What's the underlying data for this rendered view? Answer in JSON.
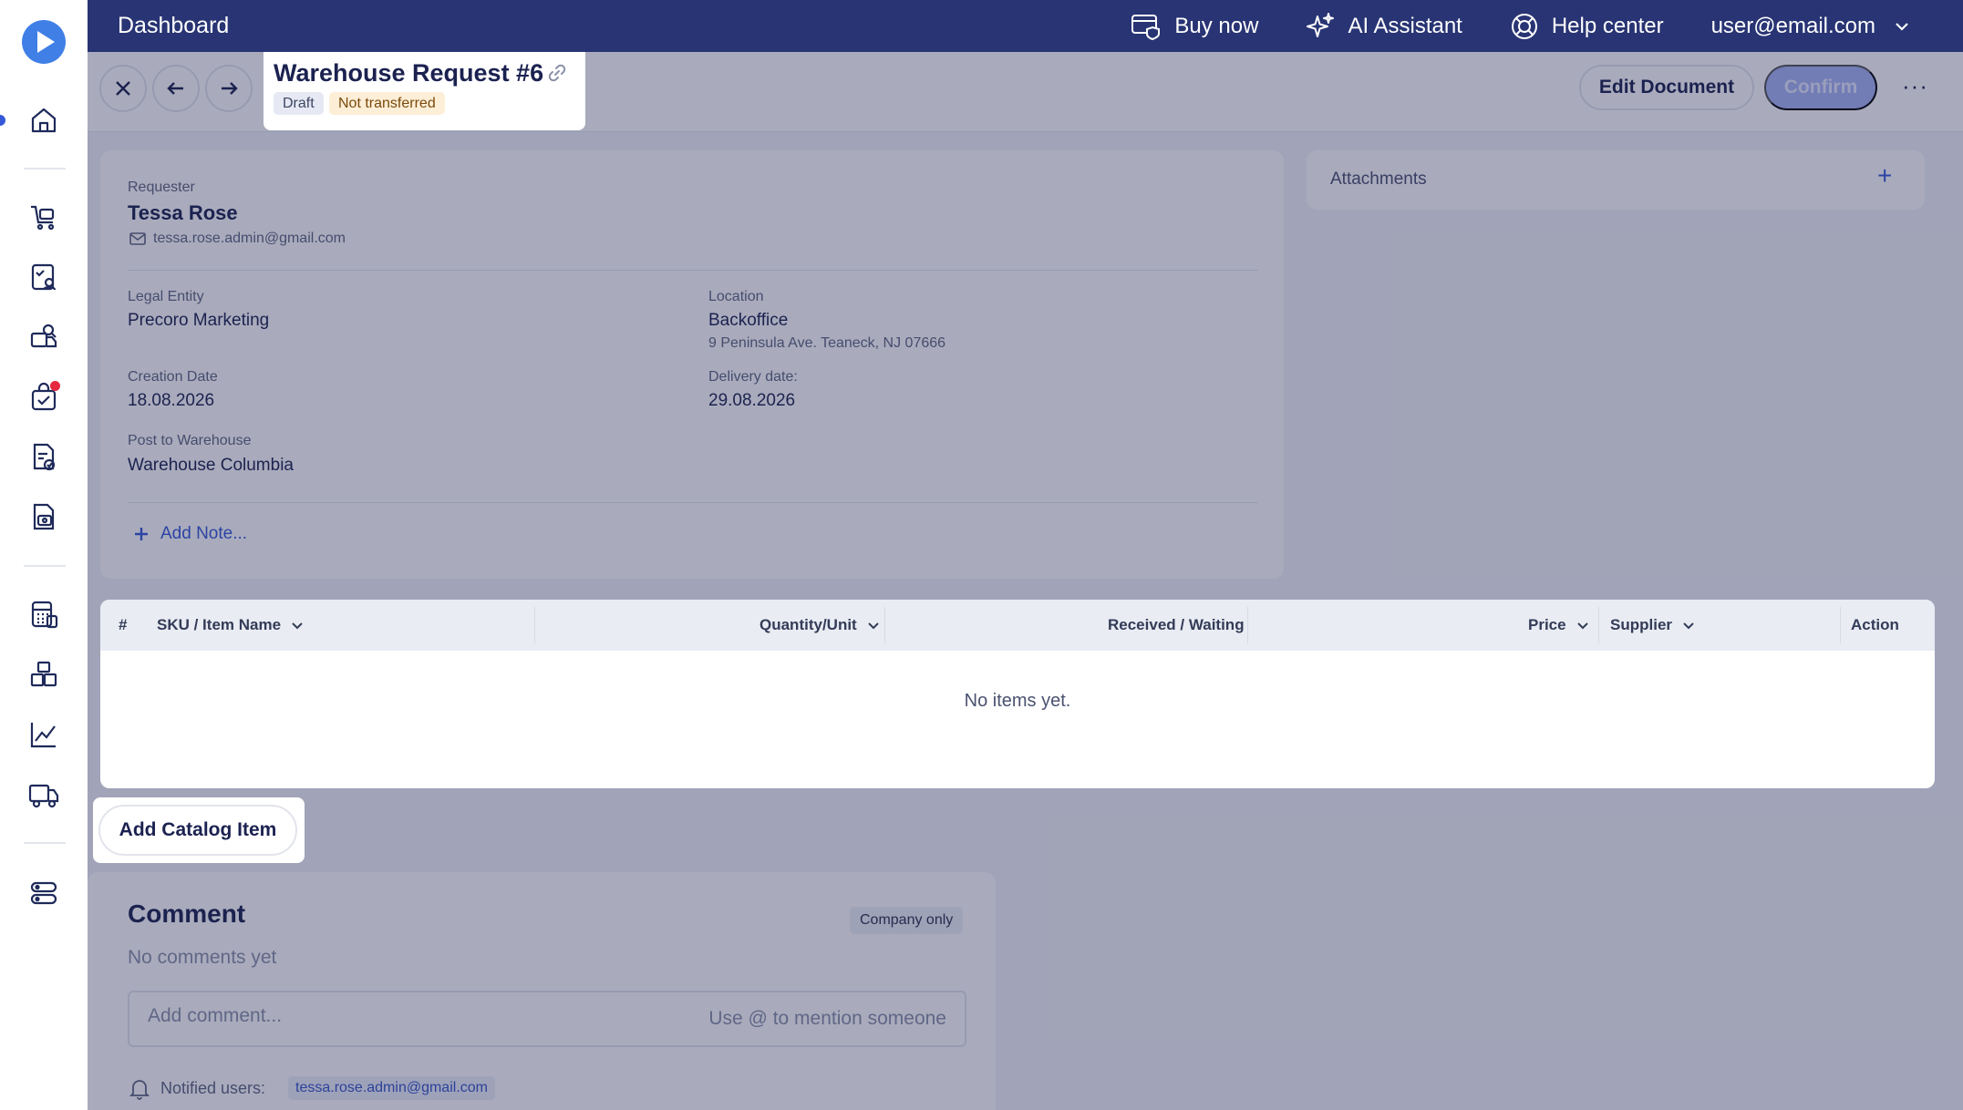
{
  "topnav": {
    "title": "Dashboard",
    "buy_now": "Buy now",
    "ai_assistant": "AI Assistant",
    "help_center": "Help center",
    "user_email": "user@email.com"
  },
  "document": {
    "title": "Warehouse Request #6",
    "status_draft": "Draft",
    "status_transfer": "Not transferred",
    "edit_label": "Edit Document",
    "confirm_label": "Confirm",
    "more_label": "···"
  },
  "details": {
    "requester_label": "Requester",
    "requester_name": "Tessa Rose",
    "requester_email": "tessa.rose.admin@gmail.com",
    "legal_entity_label": "Legal Entity",
    "legal_entity": "Precoro Marketing",
    "location_label": "Location",
    "location": "Backoffice",
    "location_address": "9 Peninsula Ave. Teaneck, NJ 07666",
    "creation_date_label": "Creation Date",
    "creation_date": "18.08.2026",
    "delivery_date_label": "Delivery date:",
    "delivery_date": "29.08.2026",
    "post_to_label": "Post to Warehouse",
    "post_to": "Warehouse Columbia",
    "add_note": "Add Note..."
  },
  "attachments": {
    "title": "Attachments",
    "add": "+"
  },
  "items_table": {
    "columns": [
      "#",
      "SKU / Item Name",
      "Quantity/Unit",
      "Received / Waiting",
      "Price",
      "Supplier",
      "Action"
    ],
    "empty_text": "No items yet.",
    "add_catalog_item": "Add Catalog Item"
  },
  "comments": {
    "title": "Comment",
    "visibility": "Company only",
    "empty_text": "No comments yet",
    "input_placeholder": "Add comment...",
    "mention_hint": "Use @ to mention someone",
    "notified_label": "Notified users:",
    "notified_user": "tessa.rose.admin@gmail.com"
  },
  "colors": {
    "nav_bg": "#283473",
    "accent": "#3559d8",
    "confirm_disabled": "#a7b4f4",
    "overlay": "rgba(28,35,78,0.38)"
  }
}
